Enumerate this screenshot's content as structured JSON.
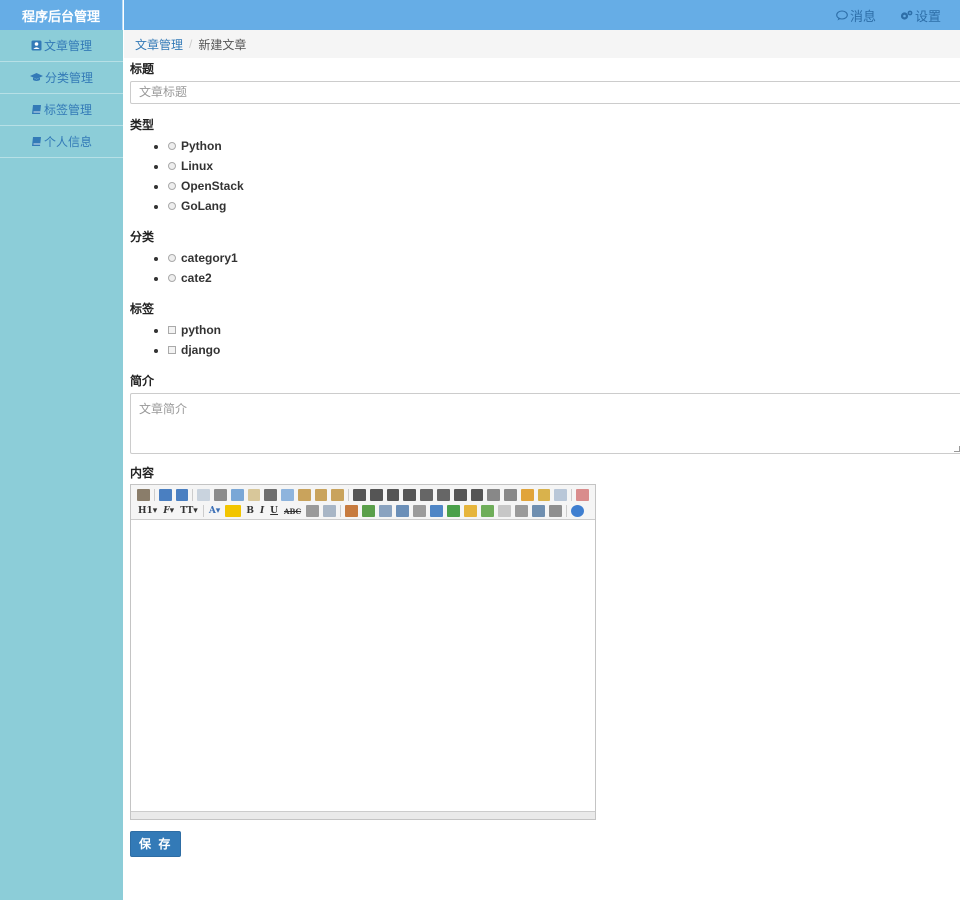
{
  "sidebar": {
    "brand": "程序后台管理",
    "items": [
      {
        "label": "文章管理",
        "icon": "user-square-icon"
      },
      {
        "label": "分类管理",
        "icon": "graduation-cap-icon"
      },
      {
        "label": "标签管理",
        "icon": "book-icon"
      },
      {
        "label": "个人信息",
        "icon": "book-icon"
      }
    ]
  },
  "topbar": {
    "messages": "消息",
    "settings": "设置"
  },
  "breadcrumb": {
    "parent": "文章管理",
    "current": "新建文章"
  },
  "form": {
    "title_label": "标题",
    "title_placeholder": "文章标题",
    "type_label": "类型",
    "types": [
      "Python",
      "Linux",
      "OpenStack",
      "GoLang"
    ],
    "category_label": "分类",
    "categories": [
      "category1",
      "cate2"
    ],
    "tag_label": "标签",
    "tags": [
      "python",
      "django"
    ],
    "summary_label": "简介",
    "summary_placeholder": "文章简介",
    "content_label": "内容",
    "save_label": "保 存"
  },
  "colors": {
    "sidebar_bg": "#8ccdd8",
    "topbar_bg": "#66ade6",
    "link": "#337ab7",
    "primary": "#337ab7"
  }
}
